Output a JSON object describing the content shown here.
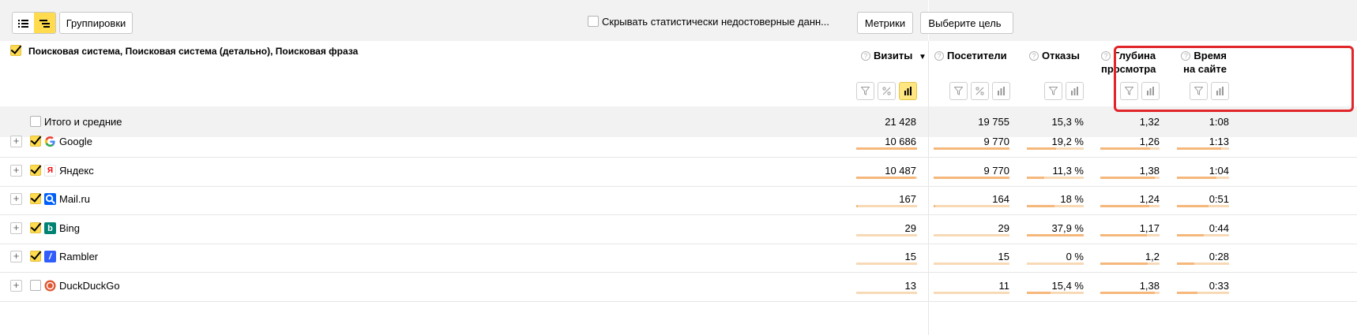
{
  "toolbar": {
    "groupings_label": "Группировки",
    "hide_unreliable_label": "Скрывать статистически недостоверные данн...",
    "metrics_label": "Метрики",
    "goal_label": "Выберите цель"
  },
  "header": {
    "dimension_title": "Поисковая система, Поисковая система (детально), Поисковая фраза",
    "columns": [
      {
        "label": "Визиты",
        "sort": "▼"
      },
      {
        "label": "Посетители"
      },
      {
        "label": "Отказы"
      },
      {
        "label_line1": "Глубина",
        "label_line2": "просмотра"
      },
      {
        "label_line1": "Время",
        "label_line2": "на сайте"
      }
    ]
  },
  "totals": {
    "label": "Итого и средние",
    "visits": "21 428",
    "visitors": "19 755",
    "bounces": "15,3 %",
    "depth": "1,32",
    "time": "1:08"
  },
  "rows": [
    {
      "name": "Google",
      "icon": "google-icon",
      "checked": true,
      "visits": "10 686",
      "visitors": "9 770",
      "bounces": "19,2 %",
      "depth": "1,26",
      "time": "1:13",
      "bars": {
        "visits": 1.0,
        "visitors": 1.0,
        "bounces": 0.51,
        "depth": 0.84,
        "time": 0.85
      }
    },
    {
      "name": "Яндекс",
      "icon": "yandex-icon",
      "checked": true,
      "visits": "10 487",
      "visitors": "9 770",
      "bounces": "11,3 %",
      "depth": "1,38",
      "time": "1:04",
      "bars": {
        "visits": 0.98,
        "visitors": 1.0,
        "bounces": 0.3,
        "depth": 0.92,
        "time": 0.75
      }
    },
    {
      "name": "Mail.ru",
      "icon": "mailru-search-icon",
      "checked": true,
      "visits": "167",
      "visitors": "164",
      "bounces": "18 %",
      "depth": "1,24",
      "time": "0:51",
      "bars": {
        "visits": 0.02,
        "visitors": 0.02,
        "bounces": 0.48,
        "depth": 0.83,
        "time": 0.6
      }
    },
    {
      "name": "Bing",
      "icon": "bing-icon",
      "checked": true,
      "visits": "29",
      "visitors": "29",
      "bounces": "37,9 %",
      "depth": "1,17",
      "time": "0:44",
      "bars": {
        "visits": 0.0,
        "visitors": 0.0,
        "bounces": 1.0,
        "depth": 0.78,
        "time": 0.52
      }
    },
    {
      "name": "Rambler",
      "icon": "rambler-icon",
      "checked": true,
      "visits": "15",
      "visitors": "15",
      "bounces": "0 %",
      "depth": "1,2",
      "time": "0:28",
      "bars": {
        "visits": 0.0,
        "visitors": 0.0,
        "bounces": 0.0,
        "depth": 0.8,
        "time": 0.33
      }
    },
    {
      "name": "DuckDuckGo",
      "icon": "duckduckgo-icon",
      "checked": false,
      "visits": "13",
      "visitors": "11",
      "bounces": "15,4 %",
      "depth": "1,38",
      "time": "0:33",
      "bars": {
        "visits": 0.0,
        "visitors": 0.0,
        "bounces": 0.41,
        "depth": 0.92,
        "time": 0.39
      }
    }
  ],
  "colors": {
    "accent": "#ffdb4d",
    "bar_fill": "#f5b77a",
    "bar_track": "#f8d9b6",
    "highlight_border": "#e0262a"
  }
}
